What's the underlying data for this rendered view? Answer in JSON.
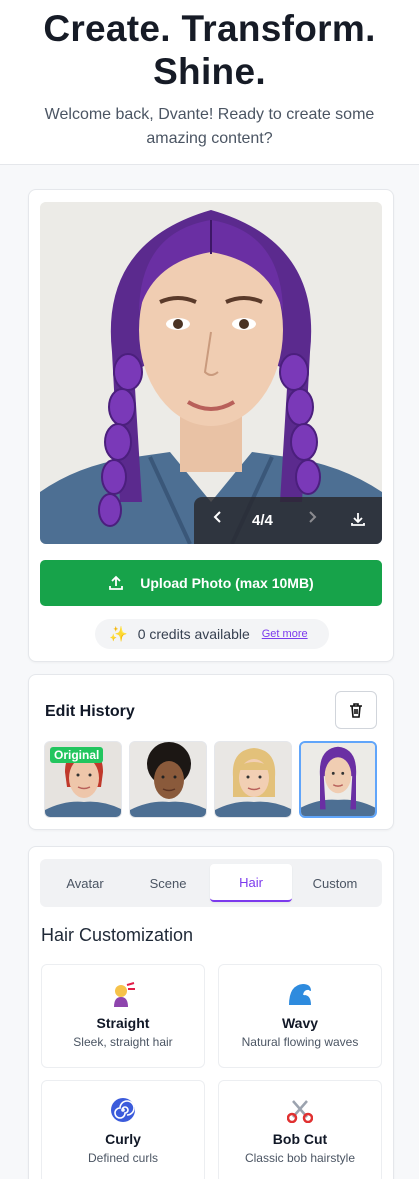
{
  "hero": {
    "title_line1": "Create. Transform.",
    "title_line2": "Shine.",
    "subtitle": "Welcome back, Dvante! Ready to create some amazing content?"
  },
  "viewer": {
    "counter": "4/4",
    "prev_icon": "chevron-left-icon",
    "next_icon": "chevron-right-icon",
    "download_icon": "download-icon"
  },
  "upload": {
    "label": "Upload Photo (max 10MB)",
    "icon": "upload-icon",
    "color": "#17a34a"
  },
  "credits": {
    "text": "0 credits available",
    "link": "Get more",
    "icon": "sparkle-icon"
  },
  "history": {
    "title": "Edit History",
    "badge": "Original",
    "thumbnails": [
      {
        "label": "Original",
        "hair": "red"
      },
      {
        "label": "",
        "hair": "curly-black"
      },
      {
        "label": "",
        "hair": "blonde-bob"
      },
      {
        "label": "",
        "hair": "purple-braids",
        "selected": true
      }
    ]
  },
  "tabs": {
    "items": [
      "Avatar",
      "Scene",
      "Hair",
      "Custom"
    ],
    "active": "Hair",
    "accent": "#7c3aed"
  },
  "customization": {
    "title": "Hair Customization",
    "options": [
      {
        "name": "Straight",
        "desc": "Sleek, straight hair",
        "icon": "haircut-person-icon"
      },
      {
        "name": "Wavy",
        "desc": "Natural flowing waves",
        "icon": "wave-icon"
      },
      {
        "name": "Curly",
        "desc": "Defined curls",
        "icon": "spiral-icon"
      },
      {
        "name": "Bob Cut",
        "desc": "Classic bob hairstyle",
        "icon": "scissors-icon"
      }
    ]
  }
}
